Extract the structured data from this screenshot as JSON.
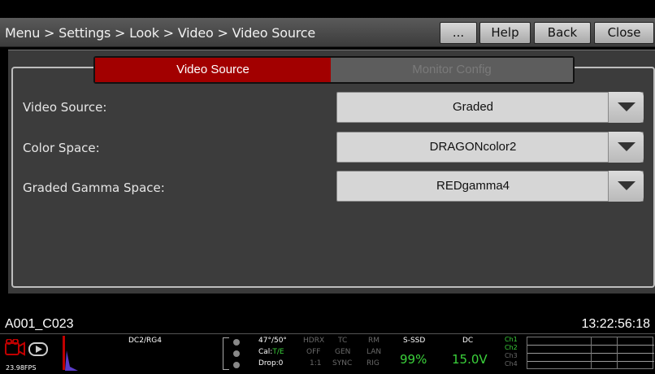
{
  "titlebar": {
    "breadcrumb": "Menu > Settings > Look > Video > Video Source",
    "more_label": "...",
    "help_label": "Help",
    "back_label": "Back",
    "close_label": "Close"
  },
  "tabs": [
    {
      "label": "Video Source",
      "active": true
    },
    {
      "label": "Monitor Config",
      "active": false
    }
  ],
  "settings": [
    {
      "label": "Video Source:",
      "value": "Graded"
    },
    {
      "label": "Color Space:",
      "value": "DRAGONcolor2"
    },
    {
      "label": "Graded Gamma Space:",
      "value": "REDgamma4"
    }
  ],
  "status": {
    "clip_name": "A001_C023",
    "timecode": "13:22:56:18",
    "fps": "23.98FPS",
    "look": "DC2/RG4",
    "temp": "47°/50°",
    "cal_prefix": "Cal:",
    "cal_value": "T/E",
    "drop": "Drop:0",
    "hdrx": "HDRX",
    "off": "OFF",
    "ratio": "1:1",
    "tc": "TC",
    "gen": "GEN",
    "sync": "SYNC",
    "rm": "RM",
    "lan": "LAN",
    "rig": "RIG",
    "media_label": "S-SSD",
    "media_value": "99%",
    "power_label": "DC",
    "power_value": "15.0V",
    "channels": [
      "Ch1",
      "Ch2",
      "Ch3",
      "Ch4"
    ]
  },
  "colors": {
    "accent": "#a20000",
    "status_green": "#3bd23b"
  }
}
